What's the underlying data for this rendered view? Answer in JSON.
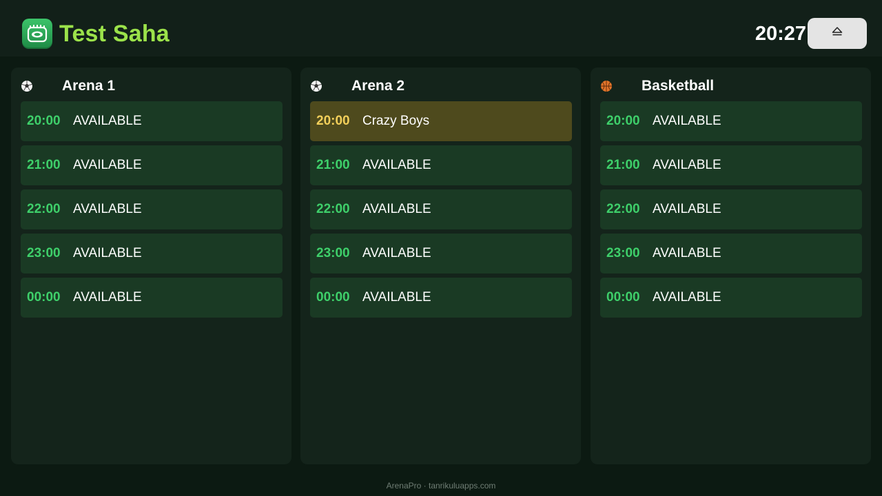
{
  "header": {
    "title": "Test Saha",
    "clock": "20:27",
    "logo_icon": "stadium-icon",
    "eject_icon": "eject-icon"
  },
  "colors": {
    "accent_title": "#9be24a",
    "available_time": "#3ecf6a",
    "booked_time": "#f2cf5a",
    "available_bg": "#1a3a24",
    "booked_bg": "#4e4a1d"
  },
  "arenas": [
    {
      "name": "Arena 1",
      "icon": "soccer-ball-icon",
      "slots": [
        {
          "time": "20:00",
          "status": "AVAILABLE",
          "booked": false
        },
        {
          "time": "21:00",
          "status": "AVAILABLE",
          "booked": false
        },
        {
          "time": "22:00",
          "status": "AVAILABLE",
          "booked": false
        },
        {
          "time": "23:00",
          "status": "AVAILABLE",
          "booked": false
        },
        {
          "time": "00:00",
          "status": "AVAILABLE",
          "booked": false
        }
      ]
    },
    {
      "name": "Arena 2",
      "icon": "soccer-ball-icon",
      "slots": [
        {
          "time": "20:00",
          "status": "Crazy Boys",
          "booked": true
        },
        {
          "time": "21:00",
          "status": "AVAILABLE",
          "booked": false
        },
        {
          "time": "22:00",
          "status": "AVAILABLE",
          "booked": false
        },
        {
          "time": "23:00",
          "status": "AVAILABLE",
          "booked": false
        },
        {
          "time": "00:00",
          "status": "AVAILABLE",
          "booked": false
        }
      ]
    },
    {
      "name": "Basketball",
      "icon": "basketball-icon",
      "slots": [
        {
          "time": "20:00",
          "status": "AVAILABLE",
          "booked": false
        },
        {
          "time": "21:00",
          "status": "AVAILABLE",
          "booked": false
        },
        {
          "time": "22:00",
          "status": "AVAILABLE",
          "booked": false
        },
        {
          "time": "23:00",
          "status": "AVAILABLE",
          "booked": false
        },
        {
          "time": "00:00",
          "status": "AVAILABLE",
          "booked": false
        }
      ]
    }
  ],
  "footer": {
    "text": "ArenaPro · tanrikuluapps.com"
  }
}
